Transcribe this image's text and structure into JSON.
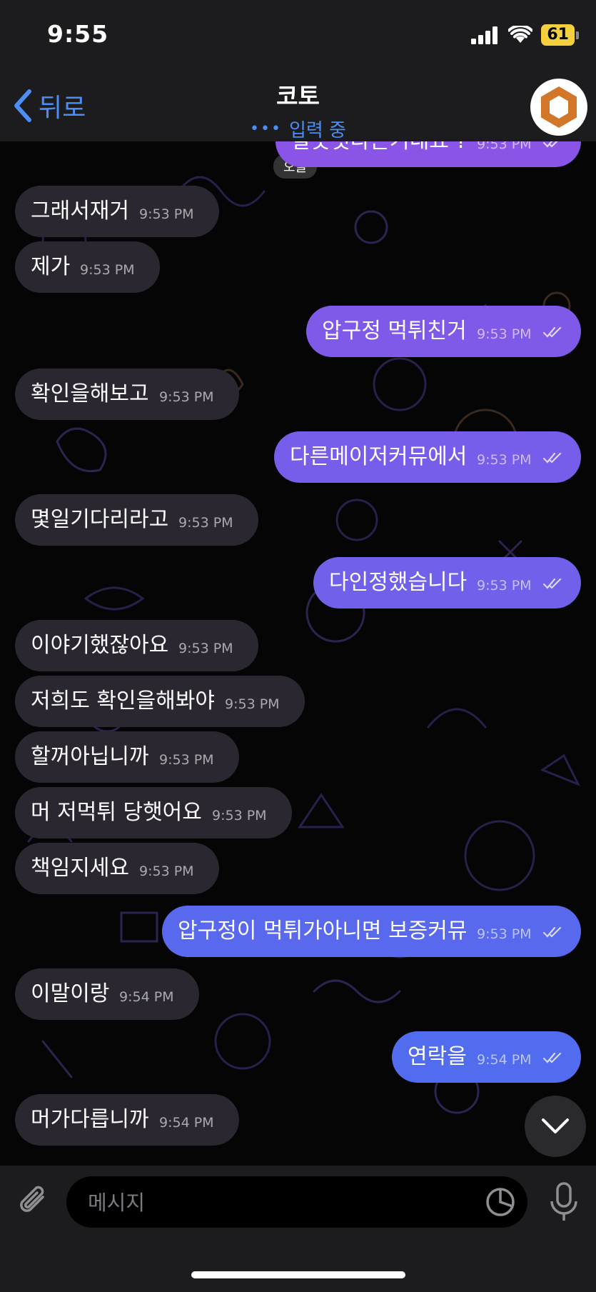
{
  "status": {
    "time": "9:55",
    "battery": "61"
  },
  "header": {
    "back_label": "뒤로",
    "title": "코토",
    "typing_dots": "•••",
    "typing_label": "입력 중"
  },
  "chat": {
    "date_label": "오늘",
    "messages": [
      {
        "dir": "out",
        "text": "잘못됫다는거네요 ?",
        "time": "9:53 PM"
      },
      {
        "dir": "in",
        "text": "그래서재거",
        "time": "9:53 PM"
      },
      {
        "dir": "in",
        "text": "제가",
        "time": "9:53 PM"
      },
      {
        "dir": "out",
        "text": "압구정 먹튀친거",
        "time": "9:53 PM"
      },
      {
        "dir": "in",
        "text": "확인을해보고",
        "time": "9:53 PM"
      },
      {
        "dir": "out",
        "text": "다른메이저커뮤에서",
        "time": "9:53 PM"
      },
      {
        "dir": "in",
        "text": "몇일기다리라고",
        "time": "9:53 PM"
      },
      {
        "dir": "out",
        "text": "다인정했습니다",
        "time": "9:53 PM"
      },
      {
        "dir": "in",
        "text": "이야기했잖아요",
        "time": "9:53 PM"
      },
      {
        "dir": "in",
        "text": "저희도 확인을해봐야",
        "time": "9:53 PM"
      },
      {
        "dir": "in",
        "text": "할꺼아닙니까",
        "time": "9:53 PM"
      },
      {
        "dir": "in",
        "text": "머 저먹튀 당햇어요",
        "time": "9:53 PM"
      },
      {
        "dir": "in",
        "text": "책임지세요",
        "time": "9:53 PM"
      },
      {
        "dir": "out",
        "text": "압구정이 먹튀가아니면 보증커뮤",
        "time": "9:53 PM"
      },
      {
        "dir": "in",
        "text": "이말이랑",
        "time": "9:54 PM"
      },
      {
        "dir": "out",
        "text": "연락을",
        "time": "9:54 PM"
      },
      {
        "dir": "in",
        "text": "머가다릅니까",
        "time": "9:54 PM"
      }
    ]
  },
  "composer": {
    "placeholder": "메시지"
  },
  "colors": {
    "accent": "#4c8ef7",
    "incoming": "#2a2730",
    "outgoing_top": "#8a55e6",
    "outgoing_bottom": "#5a6ef0"
  },
  "icons": [
    "back-chevron-icon",
    "signal-icon",
    "wifi-icon",
    "battery-icon",
    "avatar-hexagon-icon",
    "read-checks-icon",
    "chevron-down-icon",
    "paperclip-icon",
    "sticker-icon",
    "microphone-icon"
  ]
}
